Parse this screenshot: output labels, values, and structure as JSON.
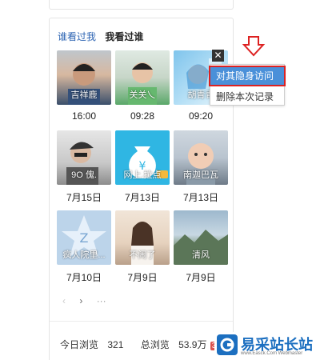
{
  "tabs": [
    {
      "label": "谁看过我"
    },
    {
      "label": "我看过谁"
    }
  ],
  "visitors": [
    {
      "name": "吉祥鹿",
      "time": "16:00"
    },
    {
      "name": "关关乀",
      "time": "09:28"
    },
    {
      "name": "胡青青",
      "time": "09:20"
    },
    {
      "name": "9O 傀.",
      "time": "7月15日"
    },
    {
      "name": "网上.拉点",
      "time": "7月13日"
    },
    {
      "name": "南迦巴瓦",
      "time": "7月13日"
    },
    {
      "name": "疯人院里...",
      "time": "7月10日"
    },
    {
      "name": "不闹了",
      "time": "7月9日"
    },
    {
      "name": "清风",
      "time": "7月9日"
    }
  ],
  "pager": {
    "prev": "‹",
    "next": "›",
    "more": "···"
  },
  "stats": {
    "today_label": "今日浏览",
    "today_value": "321",
    "total_label": "总浏览",
    "total_value": "53.9万",
    "badge": "3"
  },
  "context_menu": {
    "close": "✕",
    "hide_visit": "对其隐身访问",
    "delete_record": "删除本次记录"
  },
  "watermark": {
    "title": "易采站长站",
    "subtitle": "www.Easck.Com Webmaster"
  },
  "colors": {
    "link": "#2d64b3",
    "menu_highlight": "#4a90d9",
    "annotation_red": "#d22",
    "brand_blue": "#1c6fc0"
  }
}
